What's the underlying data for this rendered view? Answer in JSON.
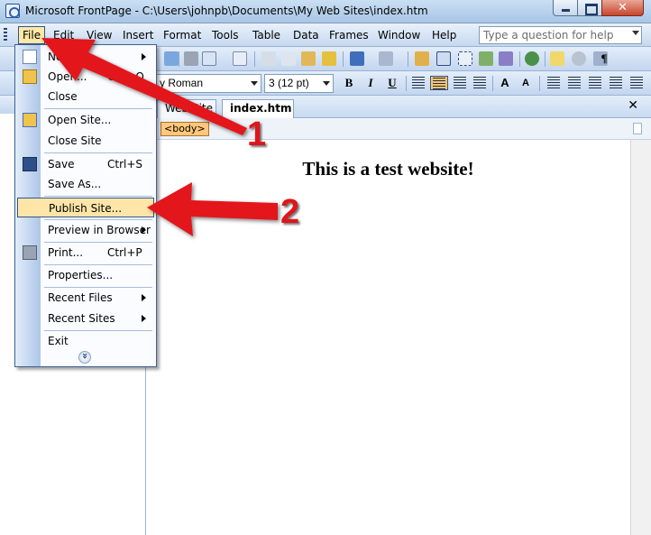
{
  "window": {
    "title": "Microsoft FrontPage - C:\\Users\\johnpb\\Documents\\My Web Sites\\index.htm",
    "close_glyph": "✕"
  },
  "menubar": {
    "items": [
      "File",
      "Edit",
      "View",
      "Insert",
      "Format",
      "Tools",
      "Table",
      "Data",
      "Frames",
      "Window",
      "Help"
    ],
    "help_placeholder": "Type a question for help"
  },
  "formatting": {
    "font_name": "y Roman",
    "font_size": "3  (12 pt)",
    "bold": "B",
    "italic": "I",
    "underline": "U",
    "grow_font": "A",
    "shrink_font": "A"
  },
  "tabs": {
    "items": [
      "Web Site",
      "index.htm"
    ],
    "active": "index.htm",
    "close_glyph": "✕"
  },
  "tag_selector": "<body>",
  "document": {
    "heading": "This is a test website!"
  },
  "file_menu": {
    "items": [
      {
        "label": "New",
        "shortcut": "",
        "submenu": false
      },
      {
        "label": "Open...",
        "shortcut": "Ctrl+O",
        "submenu": false
      },
      {
        "label": "Close",
        "shortcut": "",
        "submenu": false
      },
      {
        "label": "Open Site...",
        "shortcut": "",
        "submenu": false
      },
      {
        "label": "Close Site",
        "shortcut": "",
        "submenu": false
      },
      {
        "label": "Save",
        "shortcut": "Ctrl+S",
        "submenu": false
      },
      {
        "label": "Save As...",
        "shortcut": "",
        "submenu": false
      },
      {
        "label": "Publish Site...",
        "shortcut": "",
        "submenu": false,
        "highlighted": true
      },
      {
        "label": "Preview in Browser",
        "shortcut": "",
        "submenu": true
      },
      {
        "label": "Print...",
        "shortcut": "Ctrl+P",
        "submenu": false
      },
      {
        "label": "Properties...",
        "shortcut": "",
        "submenu": false
      },
      {
        "label": "Recent Files",
        "shortcut": "",
        "submenu": true
      },
      {
        "label": "Recent Sites",
        "shortcut": "",
        "submenu": true
      },
      {
        "label": "Exit",
        "shortcut": "",
        "submenu": false
      }
    ]
  },
  "annotations": {
    "step1": "1",
    "step2": "2",
    "arrow_color": "#e3141b"
  },
  "colors": {
    "menu_highlight": "#ffe6a8",
    "toolbar_top": "#e4eefa",
    "toolbar_bottom": "#c3d6ef"
  }
}
